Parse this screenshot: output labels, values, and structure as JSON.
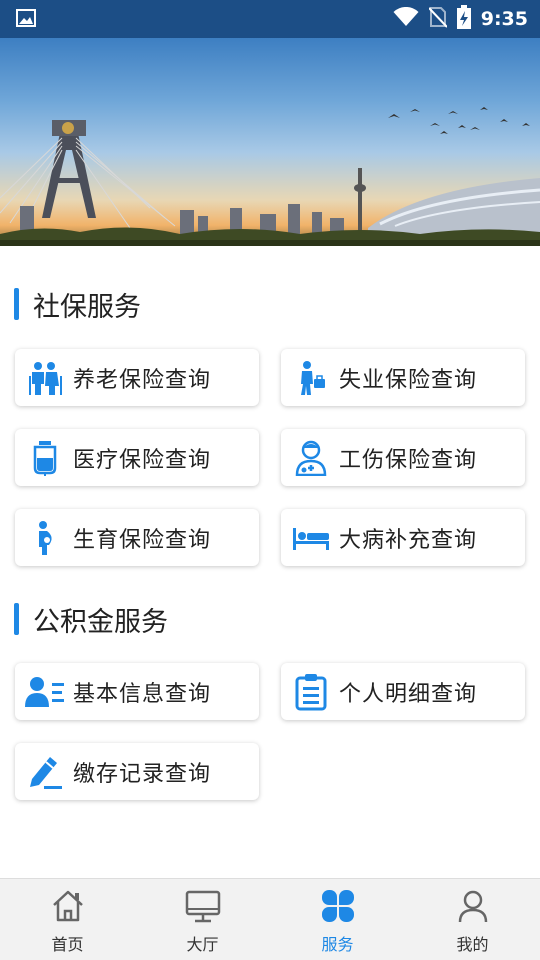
{
  "status_bar": {
    "time": "9:35"
  },
  "sections": [
    {
      "title": "社保服务",
      "items": [
        {
          "label": "养老保险查询",
          "icon": "elderly-couple-icon"
        },
        {
          "label": "失业保险查询",
          "icon": "job-seeker-icon"
        },
        {
          "label": "医疗保险查询",
          "icon": "iv-drip-icon"
        },
        {
          "label": "工伤保险查询",
          "icon": "doctor-icon"
        },
        {
          "label": "生育保险查询",
          "icon": "pregnant-woman-icon"
        },
        {
          "label": "大病补充查询",
          "icon": "hospital-bed-icon"
        }
      ]
    },
    {
      "title": "公积金服务",
      "items": [
        {
          "label": "基本信息查询",
          "icon": "user-info-icon"
        },
        {
          "label": "个人明细查询",
          "icon": "clipboard-icon"
        },
        {
          "label": "缴存记录查询",
          "icon": "pen-record-icon"
        }
      ]
    }
  ],
  "bottom_nav": [
    {
      "label": "首页",
      "icon": "home-icon"
    },
    {
      "label": "大厅",
      "icon": "monitor-icon"
    },
    {
      "label": "服务",
      "icon": "clover-icon",
      "active": true
    },
    {
      "label": "我的",
      "icon": "person-icon"
    }
  ],
  "colors": {
    "accent": "#1e88e5",
    "status_bar": "#1c4e86"
  }
}
